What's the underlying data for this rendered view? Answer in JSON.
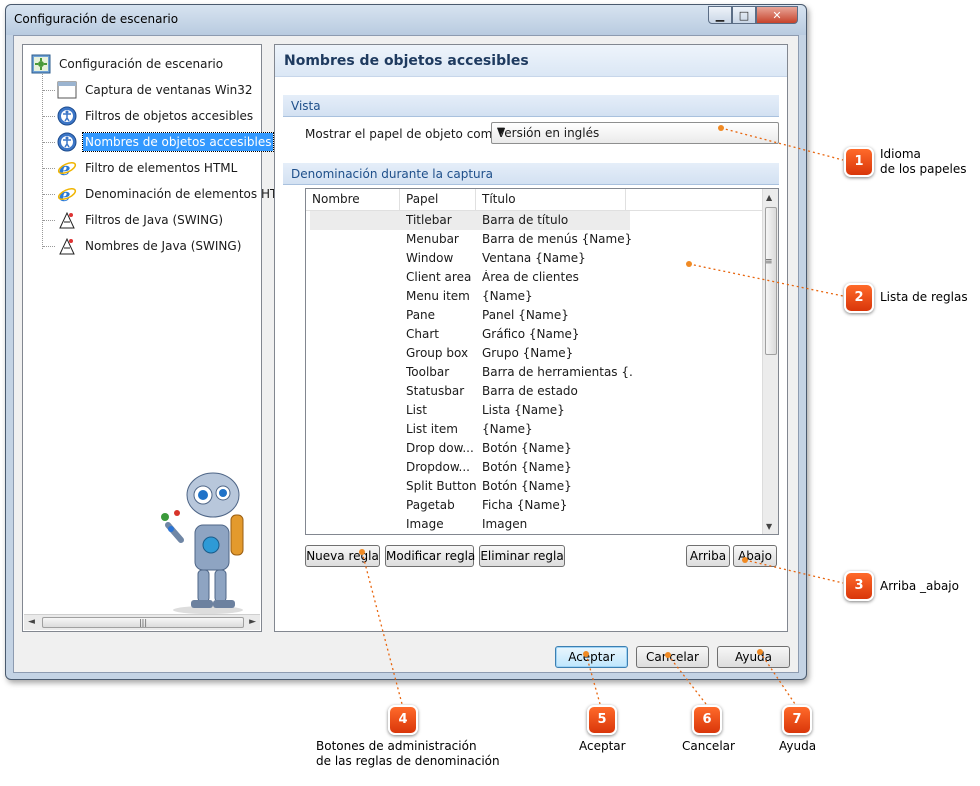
{
  "window": {
    "title": "Configuración de escenario"
  },
  "tree": {
    "items": [
      {
        "label": "Configuración de escenario",
        "icon": "settings-icon"
      },
      {
        "label": "Captura de ventanas Win32",
        "icon": "window-icon"
      },
      {
        "label": "Filtros de objetos accesibles",
        "icon": "accessibility-icon"
      },
      {
        "label": "Nombres de objetos accesibles",
        "icon": "accessibility-icon"
      },
      {
        "label": "Filtro de elementos HTML",
        "icon": "ie-icon"
      },
      {
        "label": "Denominación de elementos HTM",
        "icon": "ie-icon"
      },
      {
        "label": "Filtros de Java (SWING)",
        "icon": "java-icon"
      },
      {
        "label": "Nombres de Java (SWING)",
        "icon": "java-icon"
      }
    ],
    "selected_index": 3
  },
  "panel": {
    "title": "Nombres de objetos accesibles",
    "section_view": "Vista",
    "role_label": "Mostrar el papel de objeto como",
    "role_value": "Versión en inglés",
    "section_naming": "Denominación durante la captura",
    "columns": [
      "Nombre",
      "Papel",
      "Título"
    ],
    "rows": [
      {
        "papel": "Titlebar",
        "titulo": "Barra de título"
      },
      {
        "papel": "Menubar",
        "titulo": "Barra de menús {Name}"
      },
      {
        "papel": "Window",
        "titulo": "Ventana {Name}"
      },
      {
        "papel": "Client area",
        "titulo": "Área de clientes"
      },
      {
        "papel": "Menu item",
        "titulo": "{Name}"
      },
      {
        "papel": "Pane",
        "titulo": "Panel {Name}"
      },
      {
        "papel": "Chart",
        "titulo": "Gráfico {Name}"
      },
      {
        "papel": "Group box",
        "titulo": "Grupo {Name}"
      },
      {
        "papel": "Toolbar",
        "titulo": "Barra de herramientas {..."
      },
      {
        "papel": "Statusbar",
        "titulo": "Barra de estado"
      },
      {
        "papel": "List",
        "titulo": "Lista {Name}"
      },
      {
        "papel": "List item",
        "titulo": "{Name}"
      },
      {
        "papel": "Drop dow...",
        "titulo": "Botón {Name}"
      },
      {
        "papel": "Dropdow...",
        "titulo": "Botón {Name}"
      },
      {
        "papel": "Split Button",
        "titulo": "Botón {Name}"
      },
      {
        "papel": "Pagetab",
        "titulo": "Ficha {Name}"
      },
      {
        "papel": "Image",
        "titulo": "Imagen"
      }
    ],
    "buttons": {
      "new_rule": "Nueva regla",
      "edit_rule": "Modificar regla",
      "delete_rule": "Eliminar regla",
      "up": "Arriba",
      "down": "Abajo"
    }
  },
  "footer": {
    "ok": "Aceptar",
    "cancel": "Cancelar",
    "help": "Ayuda"
  },
  "callouts": [
    {
      "number": "1",
      "text": [
        "Idioma",
        "de los papeles"
      ]
    },
    {
      "number": "2",
      "text": [
        "Lista de reglas"
      ]
    },
    {
      "number": "3",
      "text": [
        "Arriba _abajo"
      ]
    },
    {
      "number": "4",
      "text": [
        "Botones de administración",
        "de las reglas de denominación"
      ]
    },
    {
      "number": "5",
      "text": [
        "Aceptar"
      ]
    },
    {
      "number": "6",
      "text": [
        "Cancelar"
      ]
    },
    {
      "number": "7",
      "text": [
        "Ayuda"
      ]
    }
  ],
  "colors": {
    "accent": "#3399ff",
    "badge": "#e8450f",
    "header_text": "#1e3a5f"
  }
}
